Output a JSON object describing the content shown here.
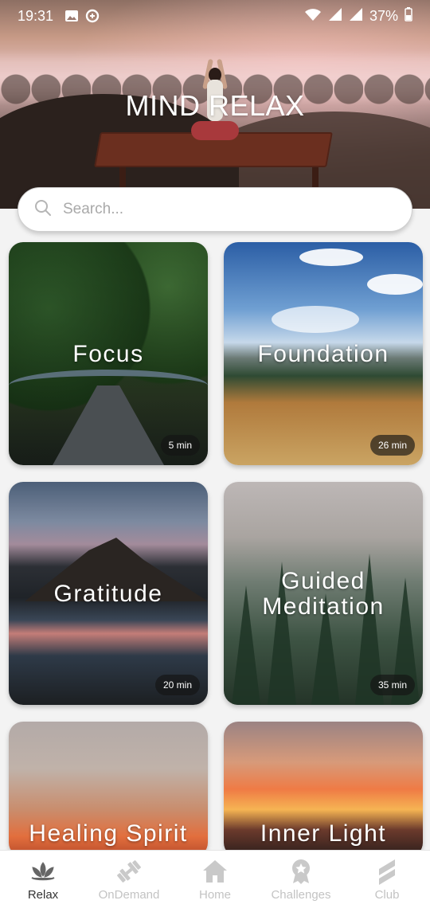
{
  "status_bar": {
    "time": "19:31",
    "battery": "37%",
    "icons": [
      "image-icon",
      "data-saver-icon",
      "wifi-icon",
      "signal-icon",
      "signal-icon",
      "battery-icon"
    ]
  },
  "header": {
    "title": "MIND RELAX"
  },
  "search": {
    "placeholder": "Search..."
  },
  "cards": [
    {
      "title": "Focus",
      "duration": "5 min"
    },
    {
      "title": "Foundation",
      "duration": "26 min"
    },
    {
      "title": "Gratitude",
      "duration": "20 min"
    },
    {
      "title_line1": "Guided",
      "title_line2": "Meditation",
      "duration": "35 min"
    },
    {
      "title": "Healing Spirit"
    },
    {
      "title": "Inner Light"
    }
  ],
  "bottom_nav": {
    "items": [
      {
        "label": "Relax",
        "icon": "lotus-icon",
        "active": true
      },
      {
        "label": "OnDemand",
        "icon": "dumbbell-icon",
        "active": false
      },
      {
        "label": "Home",
        "icon": "home-icon",
        "active": false
      },
      {
        "label": "Challenges",
        "icon": "award-icon",
        "active": false
      },
      {
        "label": "Club",
        "icon": "club-logo-icon",
        "active": false
      }
    ]
  },
  "colors": {
    "background": "#f3f3f3",
    "active_nav": "#333333",
    "inactive_nav": "#c3c3c3",
    "badge_bg": "#141414"
  }
}
